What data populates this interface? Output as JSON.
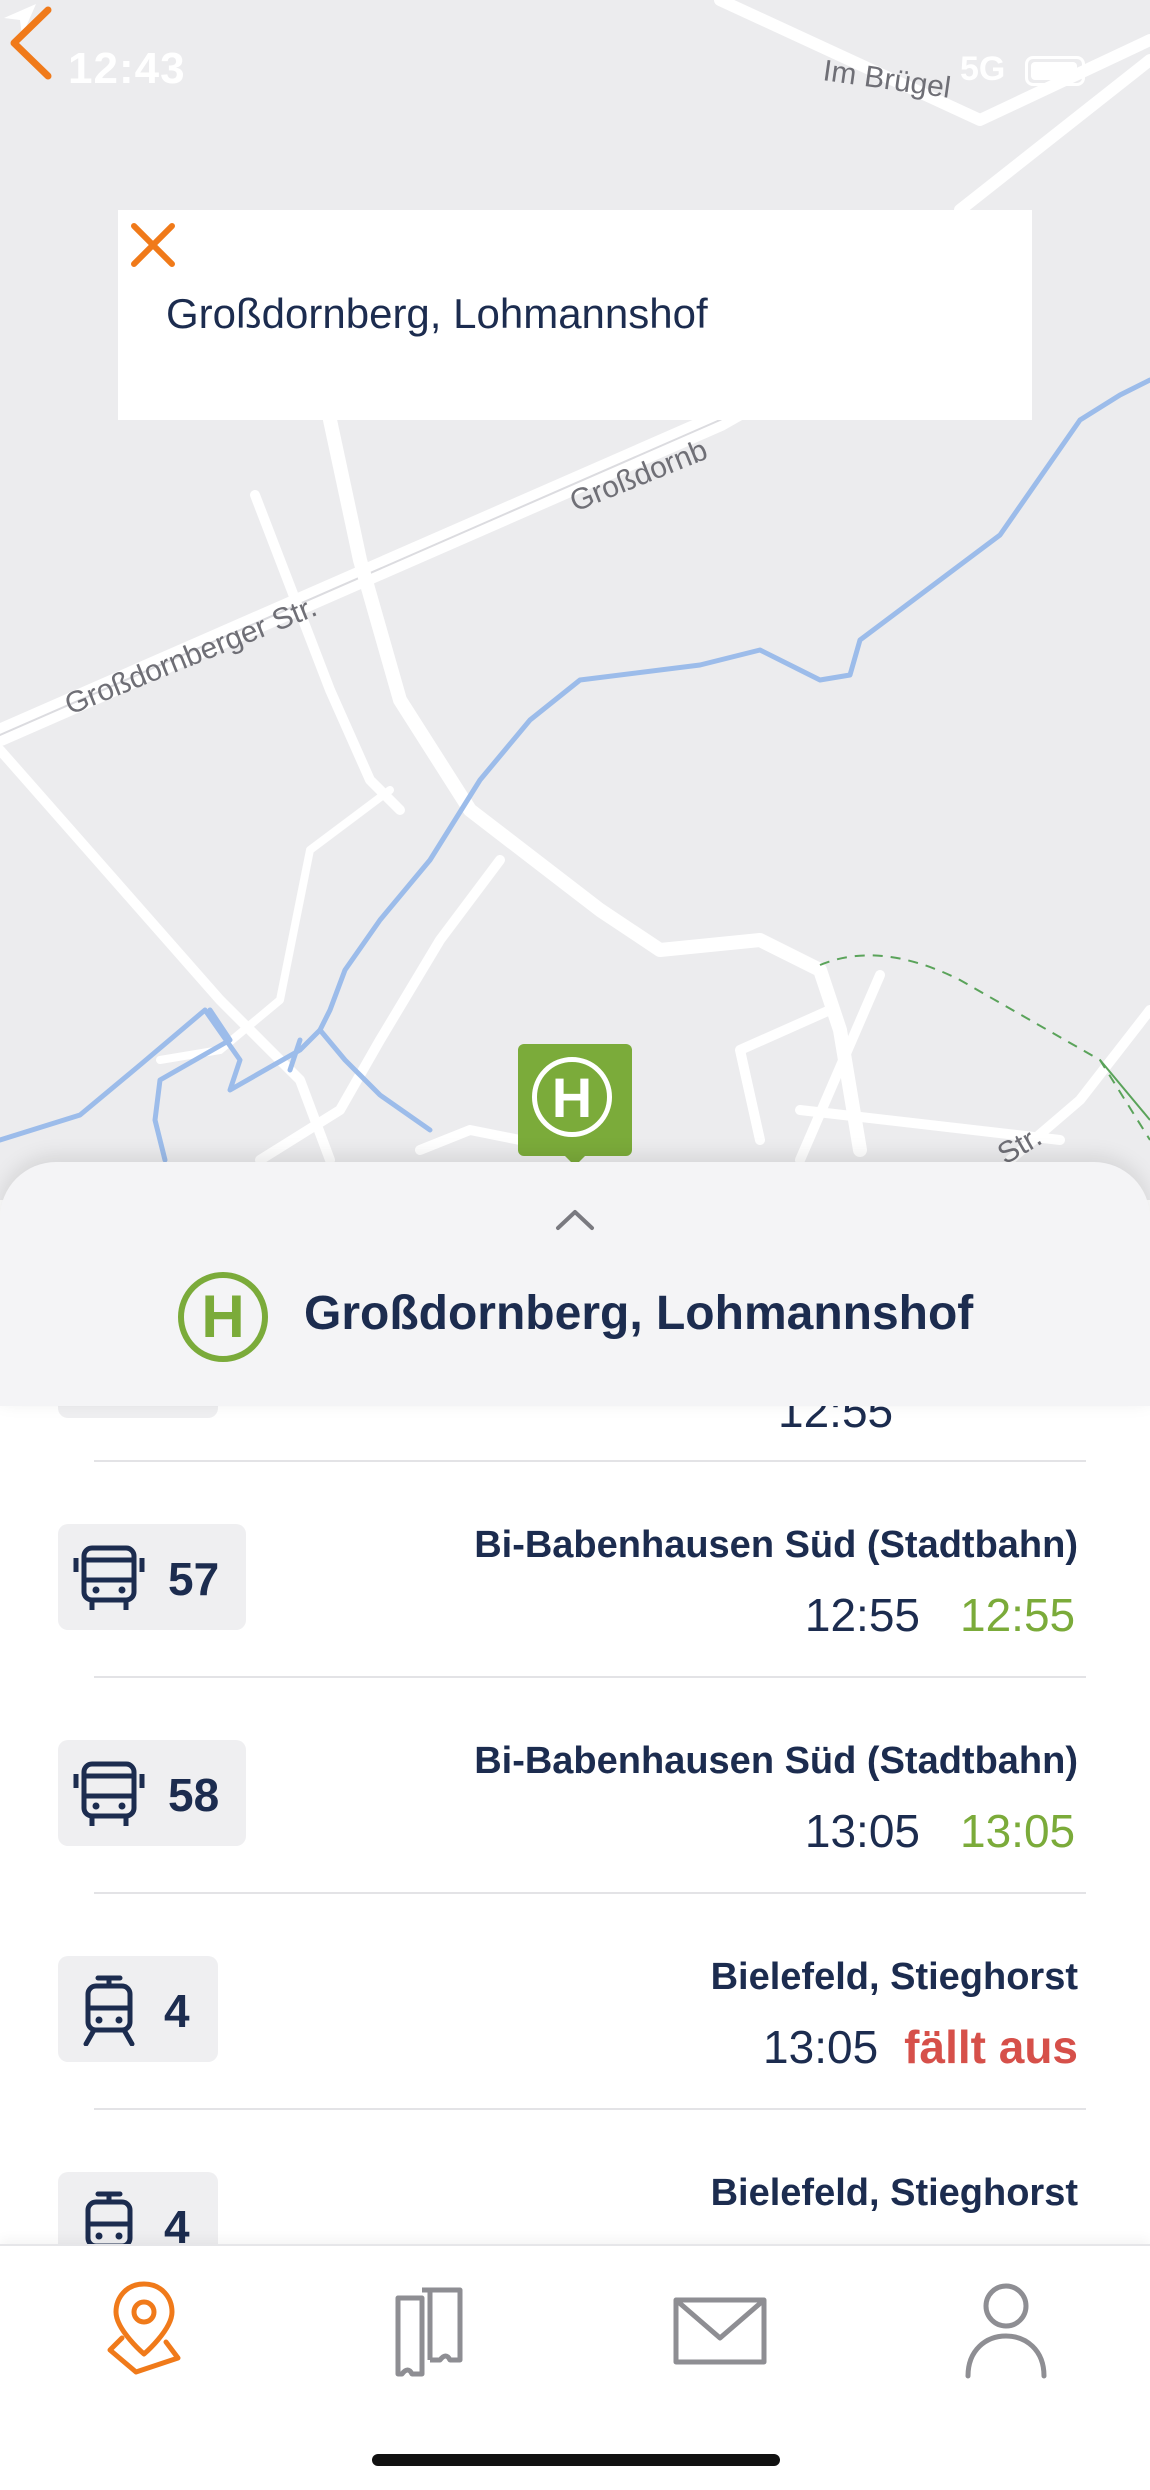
{
  "status_bar": {
    "time": "12:43",
    "network": "5G"
  },
  "map": {
    "street_labels": [
      "Im Brügel",
      "Großdornberger Str.",
      "Großdornb",
      "Str."
    ],
    "stop_marker_symbol": "H"
  },
  "search": {
    "value": "Großdornberg, Lohmannshof"
  },
  "sheet": {
    "stop_symbol": "H",
    "stop_name": "Großdornberg, Lohmannshof"
  },
  "departures": {
    "partial_time": "12:55",
    "rows": [
      {
        "type": "bus",
        "line": "57",
        "destination": "Bi-Babenhausen Süd (Stadtbahn)",
        "planned": "12:55",
        "actual": "12:55",
        "cancelled": ""
      },
      {
        "type": "bus",
        "line": "58",
        "destination": "Bi-Babenhausen Süd (Stadtbahn)",
        "planned": "13:05",
        "actual": "13:05",
        "cancelled": ""
      },
      {
        "type": "tram",
        "line": "4",
        "destination": "Bielefeld, Stieghorst",
        "planned": "13:05",
        "actual": "",
        "cancelled": "fällt aus"
      },
      {
        "type": "tram",
        "line": "4",
        "destination": "Bielefeld, Stieghorst",
        "planned": "",
        "actual": "",
        "cancelled": ""
      }
    ]
  },
  "tabbar": {
    "items": [
      "map-pin-icon",
      "tickets-icon",
      "mail-icon",
      "profile-icon"
    ],
    "active_color": "#f07a1a"
  },
  "colors": {
    "accent": "#f07a1a",
    "green": "#7bab3a",
    "cancel": "#d6504a",
    "text": "#1c2c4f"
  }
}
